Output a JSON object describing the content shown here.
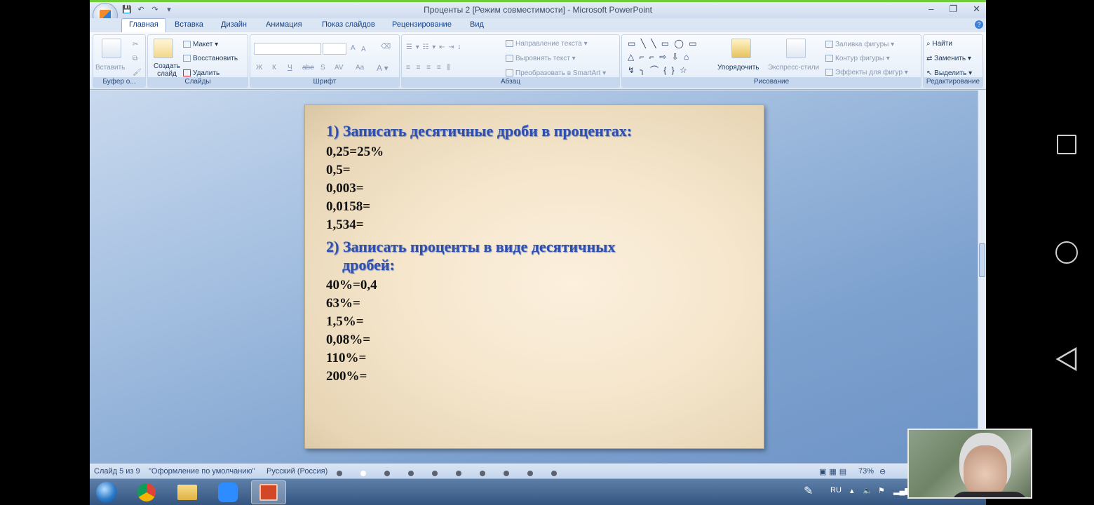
{
  "window": {
    "title": "Проценты 2 [Режим совместимости] - Microsoft PowerPoint",
    "controls": [
      "–",
      "❐",
      "✕"
    ]
  },
  "tabs": [
    "Главная",
    "Вставка",
    "Дизайн",
    "Анимация",
    "Показ слайдов",
    "Рецензирование",
    "Вид"
  ],
  "ribbon": {
    "clipboard": {
      "paste": "Вставить",
      "label": "Буфер о..."
    },
    "slides": {
      "new_slide": "Создать слайд",
      "layout": "Макет",
      "reset": "Восстановить",
      "delete": "Удалить",
      "label": "Слайды"
    },
    "font": {
      "label": "Шрифт",
      "bold": "Ж",
      "italic": "К",
      "underline": "Ч",
      "strike": "abe",
      "shadow": "S",
      "spacing": "AV",
      "case": "Aa",
      "grow": "A",
      "shrink": "A"
    },
    "paragraph": {
      "text_direction": "Направление текста",
      "align_text": "Выровнять текст",
      "smartart": "Преобразовать в SmartArt",
      "label": "Абзац"
    },
    "drawing": {
      "arrange": "Упорядочить",
      "quick_styles": "Экспресс-стили",
      "fill": "Заливка фигуры",
      "outline": "Контур фигуры",
      "effects": "Эффекты для фигур",
      "label": "Рисование"
    },
    "editing": {
      "find": "Найти",
      "replace": "Заменить",
      "select": "Выделить",
      "label": "Редактирование"
    }
  },
  "slide": {
    "heading1": "1) Записать десятичные дроби в процентах:",
    "list1": [
      "0,25=25%",
      "0,5=",
      "0,003=",
      "0,0158=",
      "1,534="
    ],
    "heading2_line1": "2) Записать проценты в виде десятичных",
    "heading2_line2": "дробей:",
    "list2": [
      "40%=0,4",
      "63%=",
      "1,5%=",
      "0,08%=",
      "110%=",
      "200%="
    ]
  },
  "status": {
    "slide_counter": "Слайд 5 из 9",
    "theme": "\"Оформление по умолчанию\"",
    "language": "Русский (Россия)",
    "zoom": "73%"
  },
  "dots": {
    "count": 10,
    "active_index": 1
  },
  "taskbar": {
    "language": "RU"
  },
  "colors": {
    "heading": "#2e4fb0",
    "accent_green": "#6fcf3a"
  }
}
